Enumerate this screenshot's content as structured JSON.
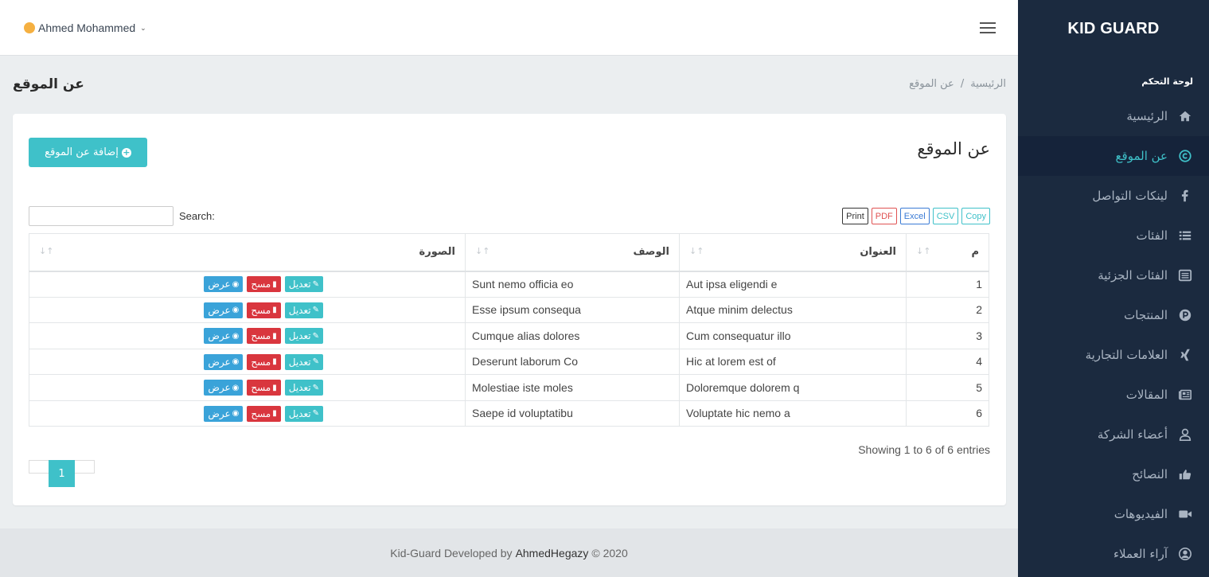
{
  "app": {
    "brand": "KID GUARD"
  },
  "topbar": {
    "user_name": "Ahmed Mohammed",
    "user_chevron": "⌄"
  },
  "sidebar": {
    "heading": "لوحة التحكم",
    "items": [
      {
        "label": "الرئيسية",
        "icon": "home-icon",
        "active": false
      },
      {
        "label": "عن الموقع",
        "icon": "copyright-icon",
        "active": true
      },
      {
        "label": "لينكات التواصل",
        "icon": "facebook-icon",
        "active": false
      },
      {
        "label": "الفئات",
        "icon": "list-icon",
        "active": false
      },
      {
        "label": "الفئات الجزئية",
        "icon": "list-alt-icon",
        "active": false
      },
      {
        "label": "المنتجات",
        "icon": "product-icon",
        "active": false
      },
      {
        "label": "العلامات التجارية",
        "icon": "xing-icon",
        "active": false
      },
      {
        "label": "المقالات",
        "icon": "newspaper-icon",
        "active": false
      },
      {
        "label": "أعضاء الشركة",
        "icon": "user-icon",
        "active": false
      },
      {
        "label": "النصائح",
        "icon": "thumbs-up-icon",
        "active": false
      },
      {
        "label": "الفيديوهات",
        "icon": "video-icon",
        "active": false
      },
      {
        "label": "آراء العملاء",
        "icon": "user-circle-icon",
        "active": false
      }
    ]
  },
  "page": {
    "title": "عن الموقع",
    "breadcrumb": {
      "home": "الرئيسية",
      "separator": "/",
      "current": "عن الموقع"
    }
  },
  "card": {
    "title": "عن الموقع",
    "add_button": "إضافة عن الموقع",
    "search_label": "Search:",
    "search_value": "",
    "export_buttons": {
      "copy": "Copy",
      "csv": "CSV",
      "excel": "Excel",
      "pdf": "PDF",
      "print": "Print"
    },
    "table": {
      "columns": [
        "م",
        "العنوان",
        "الوصف",
        "الصورة"
      ],
      "rows": [
        {
          "num": "1",
          "title": "Aut ipsa eligendi e",
          "desc": "Sunt nemo officia eo"
        },
        {
          "num": "2",
          "title": "Atque minim delectus",
          "desc": "Esse ipsum consequa"
        },
        {
          "num": "3",
          "title": "Cum consequatur illo",
          "desc": "Cumque alias dolores"
        },
        {
          "num": "4",
          "title": "Hic at lorem est of",
          "desc": "Deserunt laborum Co"
        },
        {
          "num": "5",
          "title": "Doloremque dolorem q",
          "desc": "Molestiae iste moles"
        },
        {
          "num": "6",
          "title": "Voluptate hic nemo a",
          "desc": "Saepe id voluptatibu"
        }
      ],
      "row_actions": {
        "edit": "تعديل",
        "delete": "مسح",
        "view": "عرض"
      }
    },
    "info": "Showing 1 to 6 of 6 entries",
    "pagination": {
      "current": "1"
    }
  },
  "footer": {
    "prefix": "Kid-Guard Developed by",
    "author": "AhmedHegazy",
    "suffix": "© 2020"
  }
}
